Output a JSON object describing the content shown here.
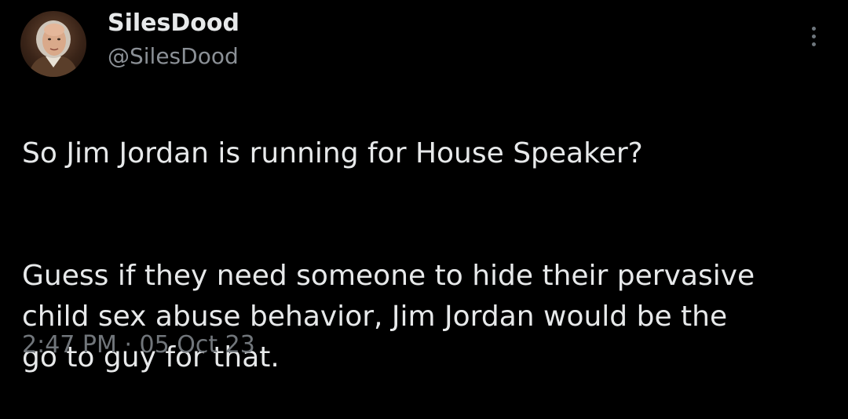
{
  "tweet": {
    "author": {
      "display_name": "SilesDood",
      "handle": "@SilesDood",
      "avatar_icon": "portrait-avatar"
    },
    "more_icon": "more-vertical-icon",
    "text": {
      "paragraph_1": "So Jim Jordan is running for House Speaker?",
      "paragraph_2": "Guess if they need someone to hide their pervasive\nchild sex abuse behavior, Jim Jordan would be the\ngo to guy for that."
    },
    "meta": {
      "time": "2:47 PM",
      "separator": "·",
      "date": "05 Oct 23"
    }
  },
  "colors": {
    "background": "#000000",
    "text_primary": "#e7e9ea",
    "text_secondary": "#71767b"
  }
}
